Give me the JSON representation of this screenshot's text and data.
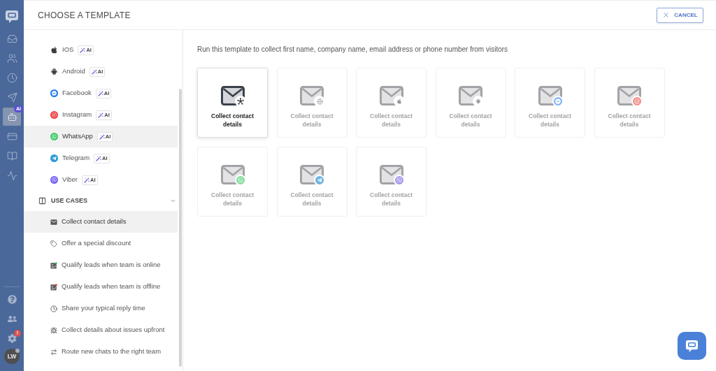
{
  "nav_rail": {
    "items": [
      {
        "selected": false
      },
      {
        "selected": false
      },
      {
        "selected": false
      },
      {
        "selected": false
      },
      {
        "selected": true,
        "badge": "AI"
      },
      {
        "selected": false
      },
      {
        "selected": false
      },
      {
        "selected": false
      }
    ],
    "bottom_items": [
      {
        "selected": false
      },
      {
        "selected": false
      },
      {
        "selected": false,
        "badge": "!"
      }
    ],
    "avatar": "LW"
  },
  "header": {
    "title": "CHOOSE A TEMPLATE",
    "cancel_button": "CANCEL"
  },
  "sidebar": {
    "channels": [
      {
        "label": "IOS",
        "badge": "AI",
        "selected": false
      },
      {
        "label": "Android",
        "badge": "AI",
        "selected": false
      },
      {
        "label": "Facebook",
        "badge": "AI",
        "selected": false
      },
      {
        "label": "Instagram",
        "badge": "AI",
        "selected": false
      },
      {
        "label": "WhatsApp",
        "badge": "AI",
        "selected": true
      },
      {
        "label": "Telegram",
        "badge": "AI",
        "selected": false
      },
      {
        "label": "Viber",
        "badge": "AI",
        "selected": false
      }
    ],
    "use_cases": {
      "title": "USE CASES",
      "expanded": true,
      "items": [
        {
          "label": "Collect contact details",
          "selected": true
        },
        {
          "label": "Offer a special discount",
          "selected": false
        },
        {
          "label": "Qualify leads when team is online",
          "selected": false
        },
        {
          "label": "Qualify leads when team is offline",
          "selected": false
        },
        {
          "label": "Share your typical reply time",
          "selected": false
        },
        {
          "label": "Collect details about issues upfront",
          "selected": false
        },
        {
          "label": "Route new chats to the right team",
          "selected": false
        }
      ]
    }
  },
  "main": {
    "description": "Run this template to collect first name, company name, email address or phone number from visitors",
    "templates": [
      {
        "label": "Collect contact details",
        "selected": true
      },
      {
        "label": "Collect contact details",
        "selected": false
      },
      {
        "label": "Collect contact details",
        "selected": false
      },
      {
        "label": "Collect contact details",
        "selected": false
      },
      {
        "label": "Collect contact details",
        "selected": false
      },
      {
        "label": "Collect contact details",
        "selected": false
      },
      {
        "label": "Collect contact details",
        "selected": false
      },
      {
        "label": "Collect contact details",
        "selected": false
      },
      {
        "label": "Collect contact details",
        "selected": false
      }
    ]
  }
}
